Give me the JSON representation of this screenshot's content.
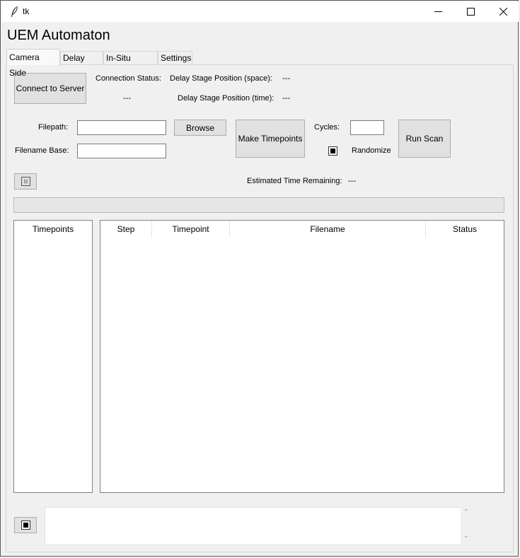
{
  "window": {
    "title": "tk"
  },
  "app": {
    "title": "UEM Automaton"
  },
  "tabs": [
    {
      "label": "Camera Side",
      "active": true
    },
    {
      "label": "Delay Side",
      "active": false
    },
    {
      "label": "In-Situ Select",
      "active": false
    },
    {
      "label": "Settings",
      "active": false
    }
  ],
  "connection": {
    "button_label": "Connect to Server",
    "status_label": "Connection Status:",
    "status_value": "---",
    "space_label": "Delay Stage Position (space):",
    "space_value": "---",
    "time_label": "Delay Stage Position (time):",
    "time_value": "---"
  },
  "file": {
    "filepath_label": "Filepath:",
    "filepath_value": "",
    "browse_label": "Browse",
    "filename_base_label": "Filename Base:",
    "filename_base_value": ""
  },
  "timepoints": {
    "make_label": "Make Timepoints"
  },
  "scan": {
    "cycles_label": "Cycles:",
    "cycles_value": "",
    "randomize_label": "Randomize",
    "randomize_checked": true,
    "run_label": "Run Scan"
  },
  "estimate": {
    "label": "Estimated Time Remaining:",
    "value": "---"
  },
  "progress": {
    "value": 0
  },
  "timepoints_list": {
    "header": "Timepoints"
  },
  "table": {
    "columns": [
      "Step",
      "Timepoint",
      "Filename",
      "Status"
    ]
  },
  "icons": {
    "pause": "pause-icon",
    "stop": "stop-icon",
    "app": "feather-icon"
  }
}
